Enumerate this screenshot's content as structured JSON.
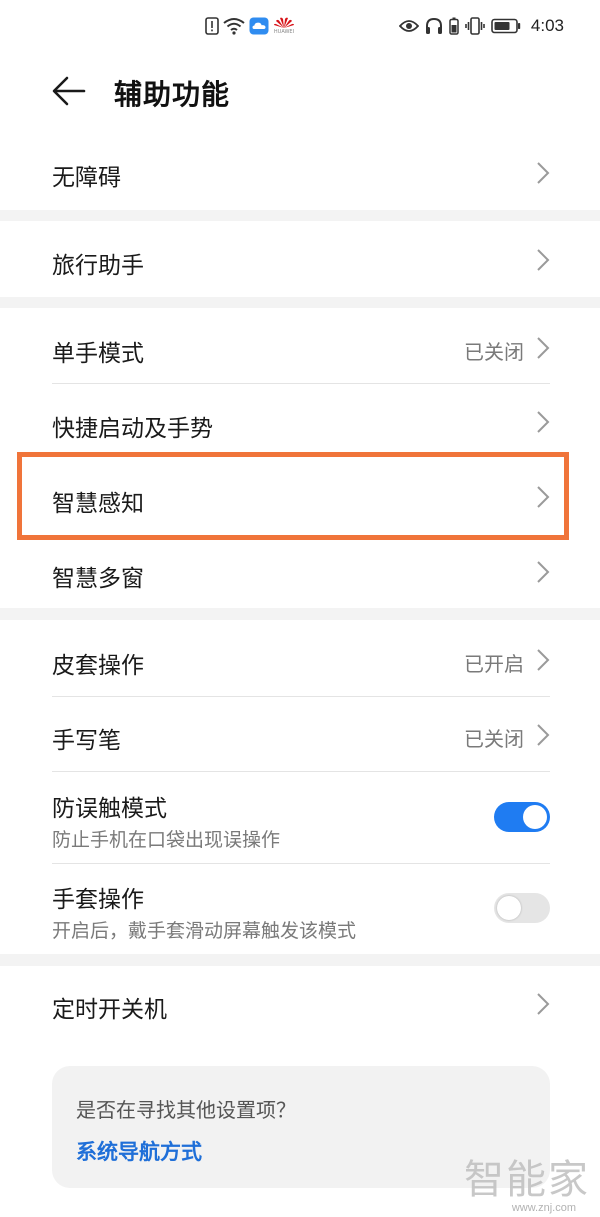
{
  "status_bar": {
    "time": "4:03",
    "brand_text": "HUAWEI",
    "icons_left": [
      "alert-icon",
      "wifi-icon",
      "cloud-icon",
      "huawei-logo-icon"
    ],
    "icons_right": [
      "eye-icon",
      "headphone-icon",
      "battery-saver-icon",
      "vibrate-icon",
      "battery-icon"
    ]
  },
  "header": {
    "title": "辅助功能"
  },
  "rows": {
    "accessibility": {
      "label": "无障碍"
    },
    "travel_assistant": {
      "label": "旅行助手"
    },
    "one_hand_mode": {
      "label": "单手模式",
      "value": "已关闭"
    },
    "quick_launch_gestures": {
      "label": "快捷启动及手势"
    },
    "smart_perception": {
      "label": "智慧感知"
    },
    "smart_multi_window": {
      "label": "智慧多窗"
    },
    "cover_operation": {
      "label": "皮套操作",
      "value": "已开启"
    },
    "stylus": {
      "label": "手写笔",
      "value": "已关闭"
    },
    "anti_mistouch": {
      "label": "防误触模式",
      "sub": "防止手机在口袋出现误操作",
      "enabled": true
    },
    "glove_mode": {
      "label": "手套操作",
      "sub": "开启后，戴手套滑动屏幕触发该模式",
      "enabled": false
    },
    "scheduled_power": {
      "label": "定时开关机"
    }
  },
  "suggestion": {
    "question": "是否在寻找其他设置项？",
    "link": "系统导航方式"
  },
  "watermark": {
    "main": "智能家",
    "url": "www.znj.com"
  },
  "colors": {
    "accent": "#1f7cf2",
    "highlight": "#f0743a",
    "link": "#1f6fd8",
    "divider_band": "#f3f3f3"
  }
}
